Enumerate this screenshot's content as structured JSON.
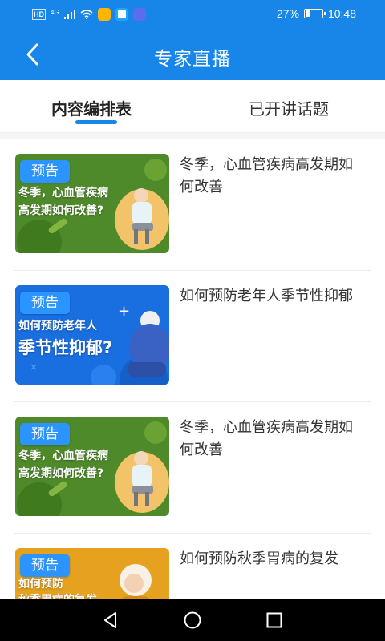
{
  "status_bar": {
    "network_badge": "HD",
    "network_type": "4G",
    "battery": "27%",
    "battery_level": 0.27,
    "time": "10:48",
    "icons": [
      "signal-icon",
      "wifi-icon",
      "app-notification-icon",
      "app-notification-icon",
      "app-notification-icon"
    ]
  },
  "header": {
    "title": "专家直播",
    "back_icon": "back-chevron-icon",
    "background_color": "#1786e8"
  },
  "tabs": [
    {
      "label": "内容编排表",
      "active": true
    },
    {
      "label": "已开讲话题",
      "active": false
    }
  ],
  "list": {
    "items": [
      {
        "badge": "预告",
        "thumb_line1": "冬季，心血管疾病",
        "thumb_line2": "高发期如何改善?",
        "title": "冬季，心血管疾病高发期如何改善",
        "theme": "green"
      },
      {
        "badge": "预告",
        "thumb_line1": "如何预防老年人",
        "thumb_line2": "季节性抑郁?",
        "title": "如何预防老年人季节性抑郁",
        "theme": "blue"
      },
      {
        "badge": "预告",
        "thumb_line1": "冬季，心血管疾病",
        "thumb_line2": "高发期如何改善?",
        "title": "冬季，心血管疾病高发期如何改善",
        "theme": "green"
      },
      {
        "badge": "预告",
        "thumb_line1": "如何预防",
        "thumb_line2": "秋季胃病的复发",
        "title": "如何预防秋季胃病的复发",
        "theme": "orange"
      }
    ]
  },
  "system_nav": {
    "back": "nav-back-icon",
    "home": "nav-home-icon",
    "recents": "nav-recents-icon"
  }
}
